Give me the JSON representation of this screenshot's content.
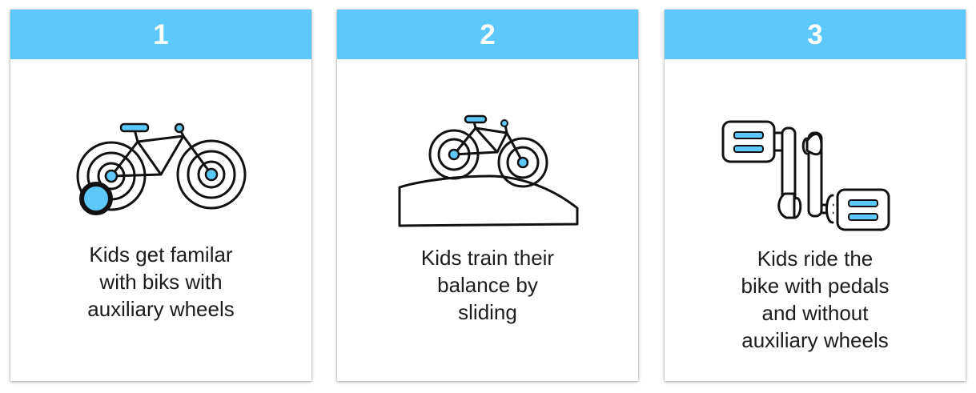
{
  "theme": {
    "accent": "#5cc8fc",
    "ink": "#111111"
  },
  "cards": [
    {
      "number": "1",
      "icon": "bike-with-training-wheels-icon",
      "caption_lines": [
        "Kids get familar",
        "with biks with",
        "auxiliary wheels"
      ]
    },
    {
      "number": "2",
      "icon": "balance-bike-on-hill-icon",
      "caption_lines": [
        "Kids train their",
        "balance by",
        "sliding"
      ]
    },
    {
      "number": "3",
      "icon": "pedals-crank-icon",
      "caption_lines": [
        "Kids ride the",
        "bike with pedals",
        "and without",
        "auxiliary wheels"
      ]
    }
  ]
}
